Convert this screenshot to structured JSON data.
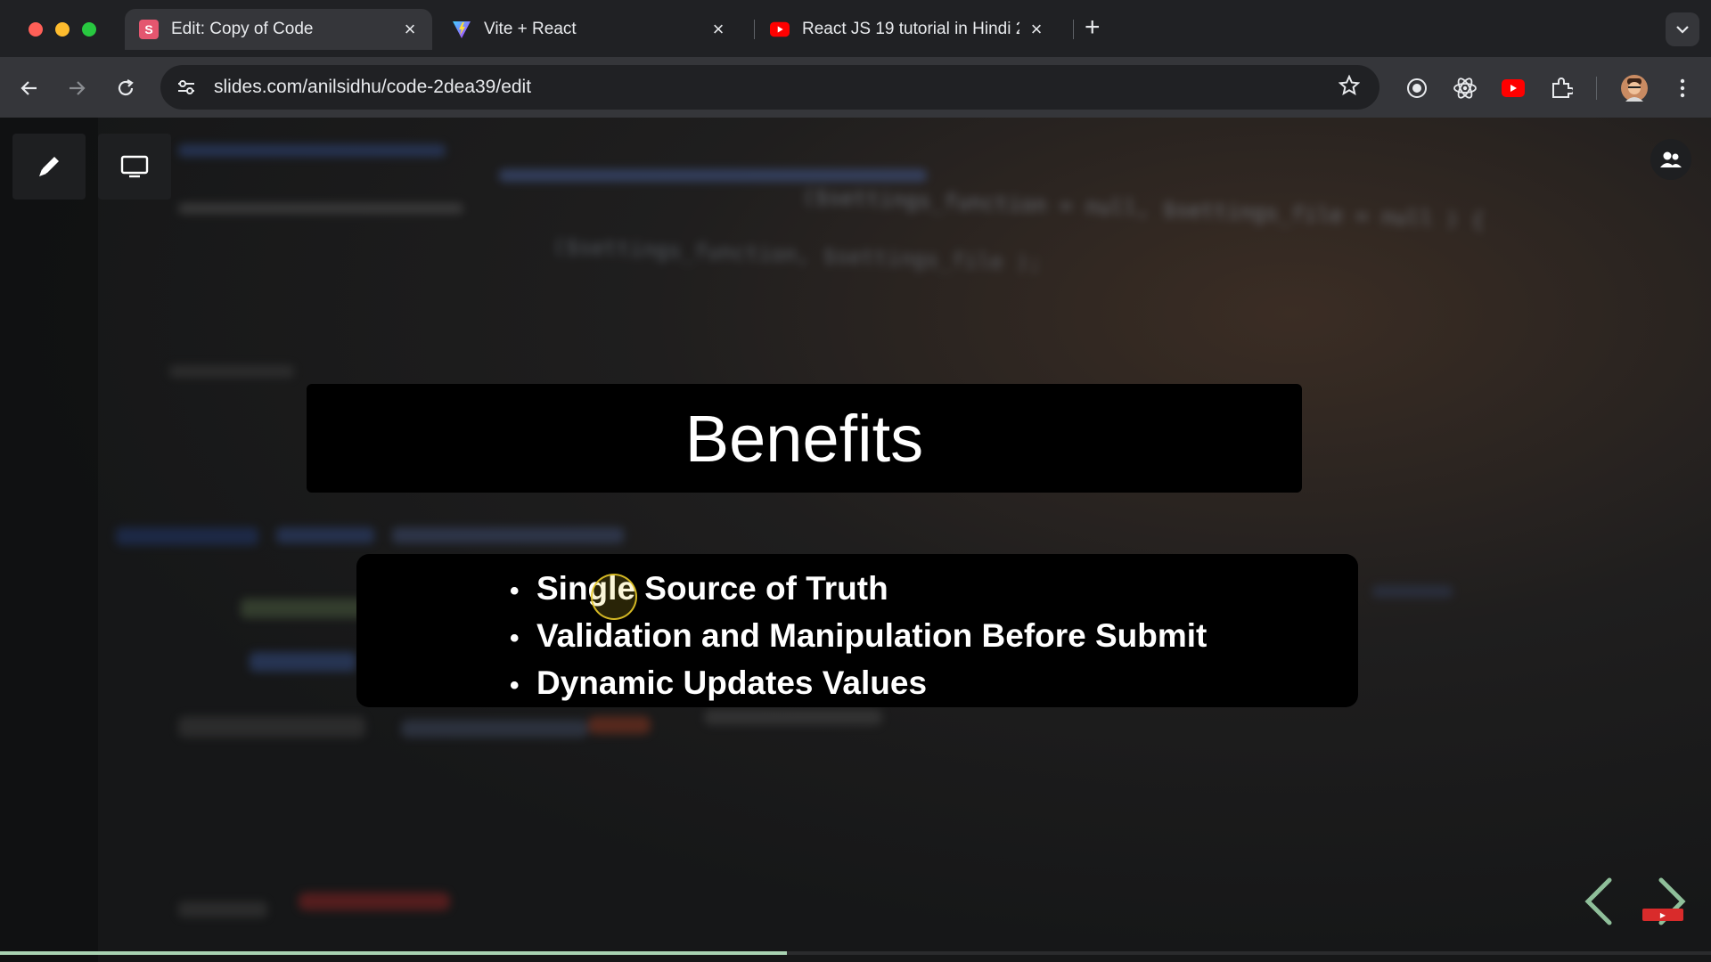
{
  "browser": {
    "tabs": [
      {
        "label": "Edit: Copy of Code",
        "favicon": "slides-icon",
        "active": true
      },
      {
        "label": "Vite + React",
        "favicon": "vite-icon",
        "active": false
      },
      {
        "label": "React JS 19 tutorial in Hindi 2",
        "favicon": "youtube-icon",
        "active": false
      }
    ],
    "new_tab": "+",
    "address": "slides.com/anilsidhu/code-2dea39/edit"
  },
  "slide": {
    "title": "Benefits",
    "bullets": [
      "Single Source of Truth",
      "Validation and Manipulation Before Submit",
      "Dynamic Updates Values"
    ],
    "progress": 0.46
  },
  "background_code": {
    "line1": "($settings_function = null, $settings_file = null ) {",
    "line2": "($settings_function, $settings_file );"
  },
  "colors": {
    "slide_box": "#000000",
    "progress": "#a9d3b3",
    "nav_prev": "#8fbf9a",
    "nav_next": "#8fbf9a"
  }
}
